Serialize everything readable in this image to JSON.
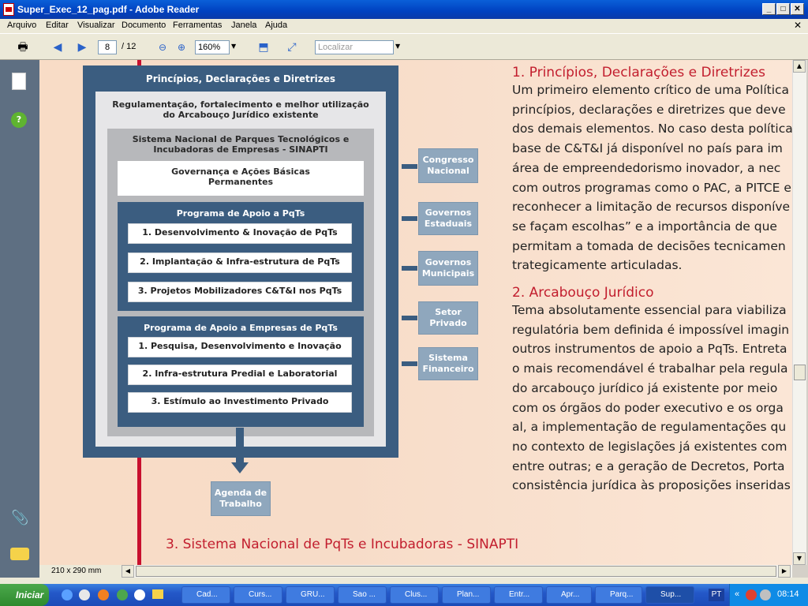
{
  "window": {
    "title": "Super_Exec_12_pag.pdf - Adobe Reader"
  },
  "menu": [
    "Arquivo",
    "Editar",
    "Visualizar",
    "Documento",
    "Ferramentas",
    "Janela",
    "Ajuda"
  ],
  "toolbar": {
    "page_current": "8",
    "page_total": "/ 12",
    "zoom": "160%",
    "search_placeholder": "Localizar"
  },
  "diagram": {
    "title": "Princípios, Declarações e Diretrizes",
    "level1": "Regulamentação, fortalecimento e melhor utilização do Arcabouço Jurídico existente",
    "level2": "Sistema Nacional de Parques Tecnológicos e Incubadoras de Empresas - SINAPTI",
    "governance": "Governança e Ações Básicas Permanentes",
    "program1": {
      "title": "Programa de Apoio a PqTs",
      "items": [
        "1. Desenvolvimento & Inovação de PqTs",
        "2. Implantação & Infra-estrutura de PqTs",
        "3. Projetos Mobilizadores C&T&I nos PqTs"
      ]
    },
    "program2": {
      "title": "Programa de Apoio a Empresas de PqTs",
      "items": [
        "1. Pesquisa, Desenvolvimento e Inovação",
        "2. Infra-estrutura Predial e Laboratorial",
        "3. Estímulo ao Investimento Privado"
      ]
    },
    "side": [
      "Congresso Nacional",
      "Governos Estaduais",
      "Governos Municipais",
      "Setor Privado",
      "Sistema Financeiro"
    ],
    "output": "Agenda de Trabalho"
  },
  "text": {
    "h1": "1. Princípios, Declarações e Diretrizes",
    "p1": [
      "Um primeiro elemento crítico de uma Política",
      "princípios, declarações e diretrizes que deve",
      "dos demais elementos. No caso desta política",
      "base de C&T&I já disponível no país para im",
      "área de empreendedorismo inovador, a nec",
      "com outros programas como o PAC, a PITCE e",
      "reconhecer a limitação de recursos disponíve",
      "se façam escolhas” e a importância de que",
      "permitam a tomada de decisões tecnicamen",
      "trategicamente articuladas."
    ],
    "h2": "2. Arcabouço Jurídico",
    "p2": [
      "Tema absolutamente essencial para viabiliza",
      "regulatória bem definida é impossível imagin",
      "outros instrumentos de apoio a PqTs. Entreta",
      "o mais recomendável é trabalhar pela regula",
      "do arcabouço jurídico já existente por meio",
      "com os órgãos do poder executivo e os orga",
      "al, a implementação de regulamentações qu",
      "no contexto de legislações já existentes com",
      "entre outras; e a geração de Decretos, Porta",
      "consistência jurídica às proposições inseridas"
    ],
    "h3": "3. Sistema Nacional de PqTs e Incubadoras - SINAPTI"
  },
  "status": {
    "page_size": "210 x 290 mm"
  },
  "taskbar": {
    "start": "Iniciar",
    "tasks": [
      "Cad...",
      "Curs...",
      "GRU...",
      "Sao ...",
      "Clus...",
      "Plan...",
      "Entr...",
      "Apr...",
      "Parq...",
      "Sup..."
    ],
    "lang": "PT",
    "clock": "08:14"
  }
}
